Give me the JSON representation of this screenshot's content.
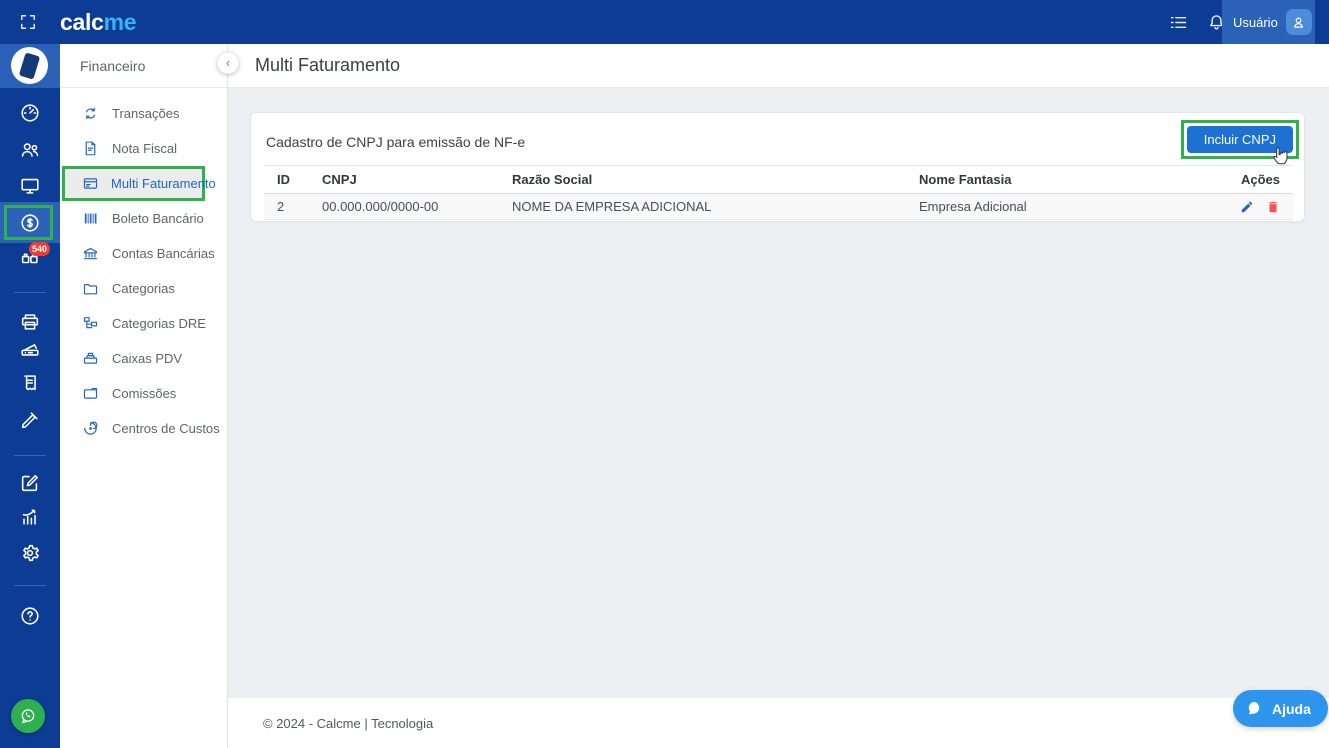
{
  "topbar": {
    "logo_part1": "calc",
    "logo_part2": "me",
    "user_label": "Usuário",
    "icons": [
      "fullscreen-icon",
      "tasks-list-icon",
      "bell-icon",
      "user-icon"
    ]
  },
  "rail": {
    "badge_count": "540",
    "icons": [
      "dashboard-icon",
      "users-icon",
      "monitor-icon",
      "dollar-icon",
      "boxes-icon",
      "printer-icon",
      "scanner-icon",
      "receipt-icon",
      "pencil-ruler-icon",
      "edit-icon",
      "analytics-icon",
      "gear-icon",
      "help-icon",
      "whatsapp-icon"
    ],
    "collapse_chevron": "‹"
  },
  "sidebar": {
    "title": "Financeiro",
    "items": [
      {
        "label": "Transações",
        "icon": "sync-icon",
        "active": false
      },
      {
        "label": "Nota Fiscal",
        "icon": "invoice-icon",
        "active": false
      },
      {
        "label": "Multi Faturamento",
        "icon": "billing-card-icon",
        "active": true
      },
      {
        "label": "Boleto Bancário",
        "icon": "barcode-icon",
        "active": false
      },
      {
        "label": "Contas Bancárias",
        "icon": "bank-icon",
        "active": false
      },
      {
        "label": "Categorias",
        "icon": "folder-icon",
        "active": false
      },
      {
        "label": "Categorias DRE",
        "icon": "hierarchy-icon",
        "active": false
      },
      {
        "label": "Caixas PDV",
        "icon": "cash-register-icon",
        "active": false
      },
      {
        "label": "Comissões",
        "icon": "wallet-icon",
        "active": false
      },
      {
        "label": "Centros de Custos",
        "icon": "spiral-icon",
        "active": false
      }
    ]
  },
  "page": {
    "title": "Multi Faturamento"
  },
  "card": {
    "title": "Cadastro de CNPJ para emissão de NF-e",
    "add_button_label": "Incluir CNPJ",
    "table": {
      "headers": [
        "ID",
        "CNPJ",
        "Razão Social",
        "Nome Fantasia",
        "Ações"
      ],
      "rows": [
        {
          "id": "2",
          "cnpj": "00.000.000/0000-00",
          "razao_social": "NOME DA EMPRESA ADICIONAL",
          "nome_fantasia": "Empresa Adicional",
          "action_icons": [
            "edit-pencil-icon",
            "delete-trash-icon"
          ]
        }
      ]
    }
  },
  "footer": {
    "copyright": "© 2024 - Calcme | Tecnologia"
  },
  "help_fab": {
    "label": "Ajuda"
  },
  "colors": {
    "topbar_blue": "#0c3c94",
    "light_blue": "#2b61b6",
    "user_icon_blue": "#4c8cdb",
    "logo_accent": "#35b5f3",
    "annotation_green": "#31b050",
    "primary_button_blue": "#1d71d3",
    "sidebar_icon_blue": "#2267c1",
    "help_fab_blue": "#2e95ef",
    "whatsapp_green": "#2fb04f",
    "badge_red": "#f23b2f",
    "delete_red": "#ee5a52",
    "content_bg": "#edeff2"
  }
}
